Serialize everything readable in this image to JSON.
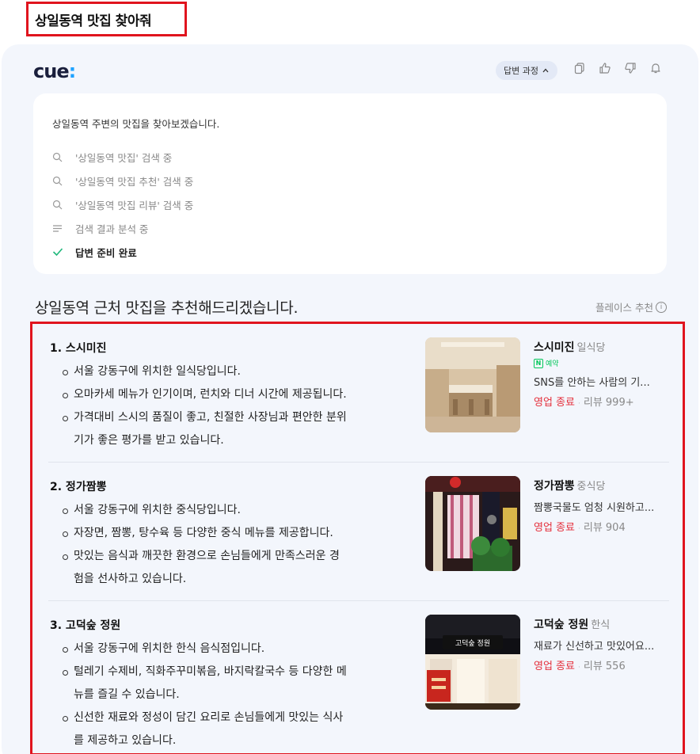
{
  "query": "상일동역 맛집 찾아줘",
  "header": {
    "logo_text": "cue",
    "logo_dot": ":",
    "process_toggle_label": "답변 과정",
    "process_toggle_icon": "chevron-up-icon",
    "tool_icons": [
      "copy-icon",
      "thumbs-up-icon",
      "thumbs-down-icon",
      "bell-icon"
    ]
  },
  "steps": {
    "intro": "상일동역 주변의 맛집을 찾아보겠습니다.",
    "items": [
      {
        "icon": "search-icon",
        "text": "'상일동역 맛집' 검색 중"
      },
      {
        "icon": "search-icon",
        "text": "'상일동역 맛집 추천' 검색 중"
      },
      {
        "icon": "search-icon",
        "text": "'상일동역 맛집 리뷰' 검색 중"
      },
      {
        "icon": "list-icon",
        "text": "검색 결과 분석 중"
      },
      {
        "icon": "check-icon",
        "text": "답변 준비 완료"
      }
    ]
  },
  "answer": {
    "title": "상일동역 근처 맛집을 추천해드리겠습니다.",
    "place_reco_label": "플레이스 추천",
    "place_reco_icon": "info-icon"
  },
  "results": [
    {
      "title": "1. 스시미진",
      "bullets": [
        [
          "서울 강동구에 위치한 일식당입니다."
        ],
        [
          "오마카세 메뉴가 인기이며, 런치와 디너 시간에 제공됩니다."
        ],
        [
          "가격대비 스시의 품질이 좋고, 친절한 사장님과 편안한 분위",
          "기가 좋은 평가를 받고 있습니다."
        ]
      ],
      "name": "스시미진",
      "category": "일식당",
      "reserve_badge": "N",
      "reserve_label": "예약",
      "review_snippet": "SNS를 안하는 사람의 기...",
      "status": "영업 종료",
      "review_count": "리뷰 999+"
    },
    {
      "title": "2. 정가짬뽕",
      "bullets": [
        [
          "서울 강동구에 위치한 중식당입니다."
        ],
        [
          "자장면, 짬뽕, 탕수육 등 다양한 중식 메뉴를 제공합니다."
        ],
        [
          "맛있는 음식과 깨끗한 환경으로 손님들에게 만족스러운 경",
          "험을 선사하고 있습니다."
        ]
      ],
      "name": "정가짬뽕",
      "category": "중식당",
      "review_snippet": "짬뽕국물도 엄청 시원하고...",
      "status": "영업 종료",
      "review_count": "리뷰 904"
    },
    {
      "title": "3. 고덕숲 정원",
      "bullets": [
        [
          "서울 강동구에 위치한 한식 음식점입니다."
        ],
        [
          "털레기 수제비, 직화주꾸미볶음, 바지락칼국수 등 다양한 메",
          "뉴를 즐길 수 있습니다."
        ],
        [
          "신선한 재료와 정성이 담긴 요리로 손님들에게 맛있는 식사",
          "를 제공하고 있습니다."
        ]
      ],
      "name": "고덕숲 정원",
      "category": "한식",
      "sign_text": "고덕숲 정원",
      "review_snippet": "재료가 신선하고 맛있어요...",
      "status": "영업 종료",
      "review_count": "리뷰 556"
    }
  ],
  "colors": {
    "highlight": "#e0141e",
    "card_bg": "#f3f6fc",
    "closed": "#e5303c",
    "check": "#1db77a",
    "naver_green": "#03c75a"
  }
}
